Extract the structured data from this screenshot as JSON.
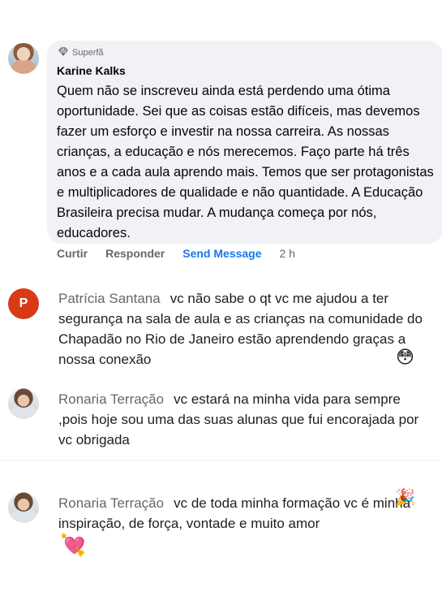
{
  "comment1": {
    "badge_label": "Superfã",
    "author": "Karine Kalks",
    "text": "Quem não se inscreveu ainda está perdendo uma ótima oportunidade. Sei que as coisas estão difíceis, mas devemos fazer um esforço e investir na nossa carreira. As nossas crianças, a educação e nós merecemos. Faço parte há três anos e a cada aula aprendo mais. Temos que ser protagonistas e multiplicadores de qualidade e não quantidade. A Educação Brasileira precisa mudar. A mudança começa por nós, educadores."
  },
  "actions": {
    "like": "Curtir",
    "reply": "Responder",
    "send_message": "Send Message",
    "time": "2 h"
  },
  "comment2": {
    "avatar_letter": "P",
    "author": "Patrícia Santana",
    "text": "vc não sabe o qt vc me ajudou a ter segurança na sala de aula e as crianças na comunidade do Chapadão no Rio de Janeiro estão aprendendo graças a nossa conexão",
    "emoji": "😳"
  },
  "comment3": {
    "author": "Ronaria Terração",
    "text": "vc estará na minha vida para sempre ,pois hoje sou uma das suas alunas que fui encorajada por vc obrigada"
  },
  "comment4": {
    "author": "Ronaria Terração",
    "text": "vc de toda minha formação vc é minha inspiração, de força, vontade e muito amor",
    "emoji_inline": "🎉",
    "emoji_after": "💘"
  }
}
